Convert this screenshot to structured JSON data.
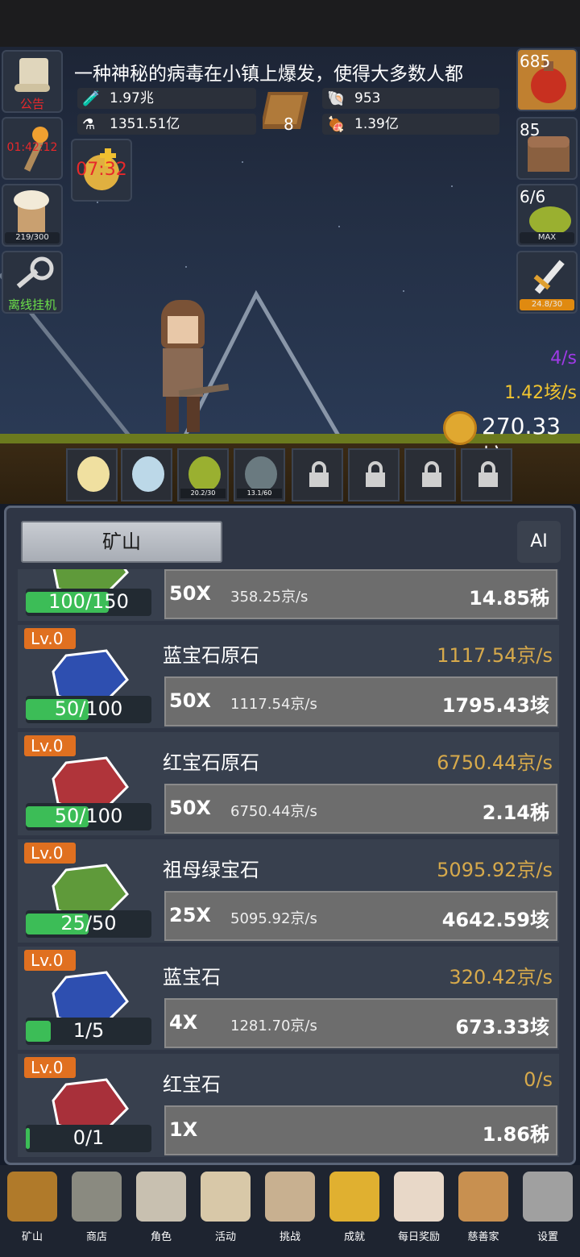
{
  "announcement": "一种神秘的病毒在小镇上爆发，使得大多数人都",
  "left_side": {
    "notice_label": "公告",
    "torch_timer": "01:42:12",
    "food_progress": "219/300",
    "offline_label": "离线挂机",
    "bag_timer": "07:32"
  },
  "stats": {
    "potion_blue": "1.97兆",
    "potion_yellow": "1351.51亿",
    "book_count": "8",
    "shell": "953",
    "meat": "1.39亿"
  },
  "right_side": {
    "potion_count": "685",
    "chest_count": "85",
    "slime_count": "6/6",
    "slime_status": "MAX",
    "sword_progress": "24.8/30"
  },
  "scene": {
    "rate_purple": "4/s",
    "rate_gold": "1.42垓/s",
    "gold_total": "270.33垓"
  },
  "slots": [
    {
      "name": "candle",
      "bar": ""
    },
    {
      "name": "egg",
      "bar": ""
    },
    {
      "name": "slime",
      "bar": "20.2/30"
    },
    {
      "name": "zombie",
      "bar": "13.1/60"
    },
    {
      "name": "locked",
      "bar": ""
    },
    {
      "name": "locked",
      "bar": ""
    },
    {
      "name": "locked",
      "bar": ""
    },
    {
      "name": "locked",
      "bar": ""
    }
  ],
  "panel": {
    "tab": "矿山",
    "ai": "AI"
  },
  "rows": [
    {
      "level": "",
      "name": "",
      "rate": "",
      "progress": "100/150",
      "fill": 0.66,
      "mult": "50X",
      "sub": "358.25京/s",
      "cost": "14.85秭",
      "color": "#5f9a3a"
    },
    {
      "level": "Lv.0",
      "name": "蓝宝石原石",
      "rate": "1117.54京/s",
      "progress": "50/100",
      "fill": 0.5,
      "mult": "50X",
      "sub": "1117.54京/s",
      "cost": "1795.43垓",
      "color": "#2e4fb0"
    },
    {
      "level": "Lv.0",
      "name": "红宝石原石",
      "rate": "6750.44京/s",
      "progress": "50/100",
      "fill": 0.5,
      "mult": "50X",
      "sub": "6750.44京/s",
      "cost": "2.14秭",
      "color": "#b0343a"
    },
    {
      "level": "Lv.0",
      "name": "祖母绿宝石",
      "rate": "5095.92京/s",
      "progress": "25/50",
      "fill": 0.5,
      "mult": "25X",
      "sub": "5095.92京/s",
      "cost": "4642.59垓",
      "color": "#5f9a3a"
    },
    {
      "level": "Lv.0",
      "name": "蓝宝石",
      "rate": "320.42京/s",
      "progress": "1/5",
      "fill": 0.2,
      "mult": "4X",
      "sub": "1281.70京/s",
      "cost": "673.33垓",
      "color": "#2e4fb0"
    },
    {
      "level": "Lv.0",
      "name": "红宝石",
      "rate": "0/s",
      "progress": "0/1",
      "fill": 0.03,
      "mult": "1X",
      "sub": "",
      "cost": "1.86秭",
      "color": "#a8303a"
    }
  ],
  "nav": [
    "矿山",
    "商店",
    "角色",
    "活动",
    "挑战",
    "成就",
    "每日奖励",
    "慈善家",
    "设置"
  ]
}
